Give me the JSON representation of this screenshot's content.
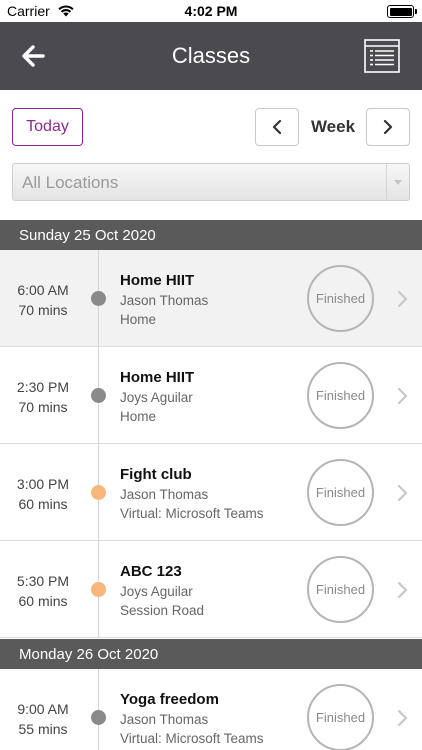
{
  "status_bar": {
    "carrier": "Carrier",
    "time": "4:02 PM"
  },
  "header": {
    "title": "Classes",
    "back_icon": "arrow-left-icon",
    "menu_icon": "list-icon"
  },
  "filters": {
    "today_label": "Today",
    "period_label": "Week",
    "location": {
      "selected": "All Locations"
    }
  },
  "colors": {
    "header_bg": "#4b4a51",
    "accent": "#8e2a8e",
    "day_header_bg": "#5a5a5a",
    "dot_grey": "#8a8a8a",
    "dot_orange": "#f7b77a"
  },
  "days": [
    {
      "label": "Sunday 25 Oct 2020",
      "classes": [
        {
          "time": "6:00 AM",
          "duration": "70 mins",
          "name": "Home HIIT",
          "instructor": "Jason Thomas",
          "location": "Home",
          "status": "Finished",
          "dot_color": "#8a8a8a",
          "highlighted": true
        },
        {
          "time": "2:30 PM",
          "duration": "70 mins",
          "name": "Home HIIT",
          "instructor": "Joys Aguilar",
          "location": "Home",
          "status": "Finished",
          "dot_color": "#8a8a8a",
          "highlighted": false
        },
        {
          "time": "3:00 PM",
          "duration": "60 mins",
          "name": "Fight club",
          "instructor": "Jason Thomas",
          "location": "Virtual: Microsoft Teams",
          "status": "Finished",
          "dot_color": "#f7b77a",
          "highlighted": false
        },
        {
          "time": "5:30 PM",
          "duration": "60 mins",
          "name": "ABC 123",
          "instructor": "Joys Aguilar",
          "location": "Session Road",
          "status": "Finished",
          "dot_color": "#f7b77a",
          "highlighted": false
        }
      ]
    },
    {
      "label": "Monday 26 Oct 2020",
      "classes": [
        {
          "time": "9:00 AM",
          "duration": "55 mins",
          "name": "Yoga freedom",
          "instructor": "Jason Thomas",
          "location": "Virtual: Microsoft Teams",
          "status": "Finished",
          "dot_color": "#8a8a8a",
          "highlighted": false
        }
      ]
    }
  ]
}
